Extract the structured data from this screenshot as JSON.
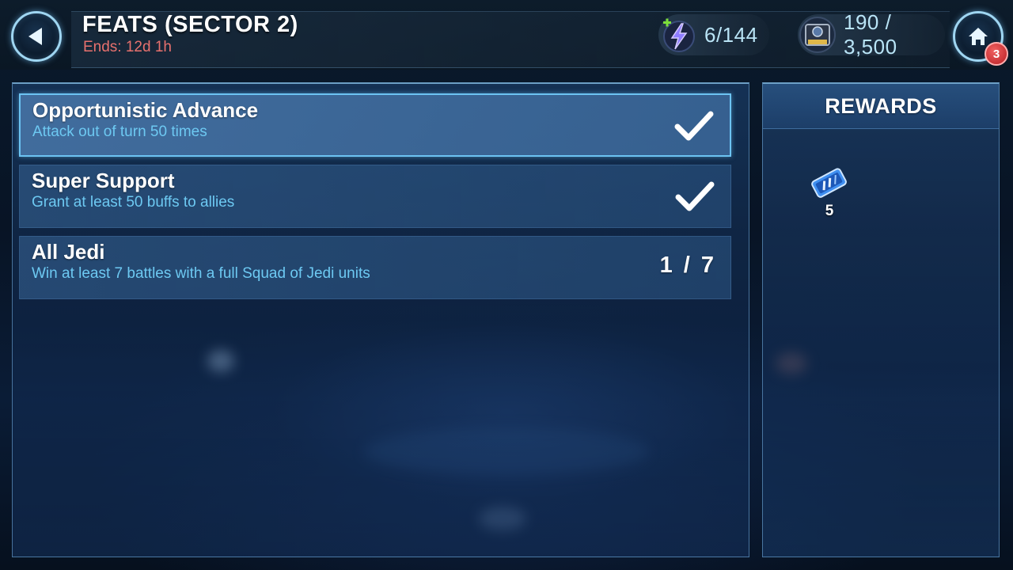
{
  "header": {
    "title": "FEATS (SECTOR 2)",
    "ends_label": "Ends: 12d 1h",
    "back_icon": "back-arrow-icon",
    "home_icon": "home-icon",
    "home_badge": "3"
  },
  "currencies": {
    "energy": {
      "value": "6/144",
      "icon": "lightning-energy-icon"
    },
    "credits": {
      "value": "190 / 3,500",
      "icon": "conquest-credits-icon"
    }
  },
  "feats": [
    {
      "title": "Opportunistic Advance",
      "description": "Attack out of turn 50 times",
      "status": "complete",
      "selected": true
    },
    {
      "title": "Super Support",
      "description": "Grant at least 50 buffs to allies",
      "status": "complete",
      "selected": false
    },
    {
      "title": "All Jedi",
      "description": "Win at least 7 battles with a full Squad of Jedi units",
      "status": "in-progress",
      "progress": "1 / 7",
      "selected": false
    }
  ],
  "rewards": {
    "title": "REWARDS",
    "items": [
      {
        "icon": "conquest-crate-key-icon",
        "count": "5"
      }
    ]
  },
  "colors": {
    "accent": "#6dc9f2",
    "ends_red": "#e8716e",
    "badge_red": "#c9262b"
  }
}
